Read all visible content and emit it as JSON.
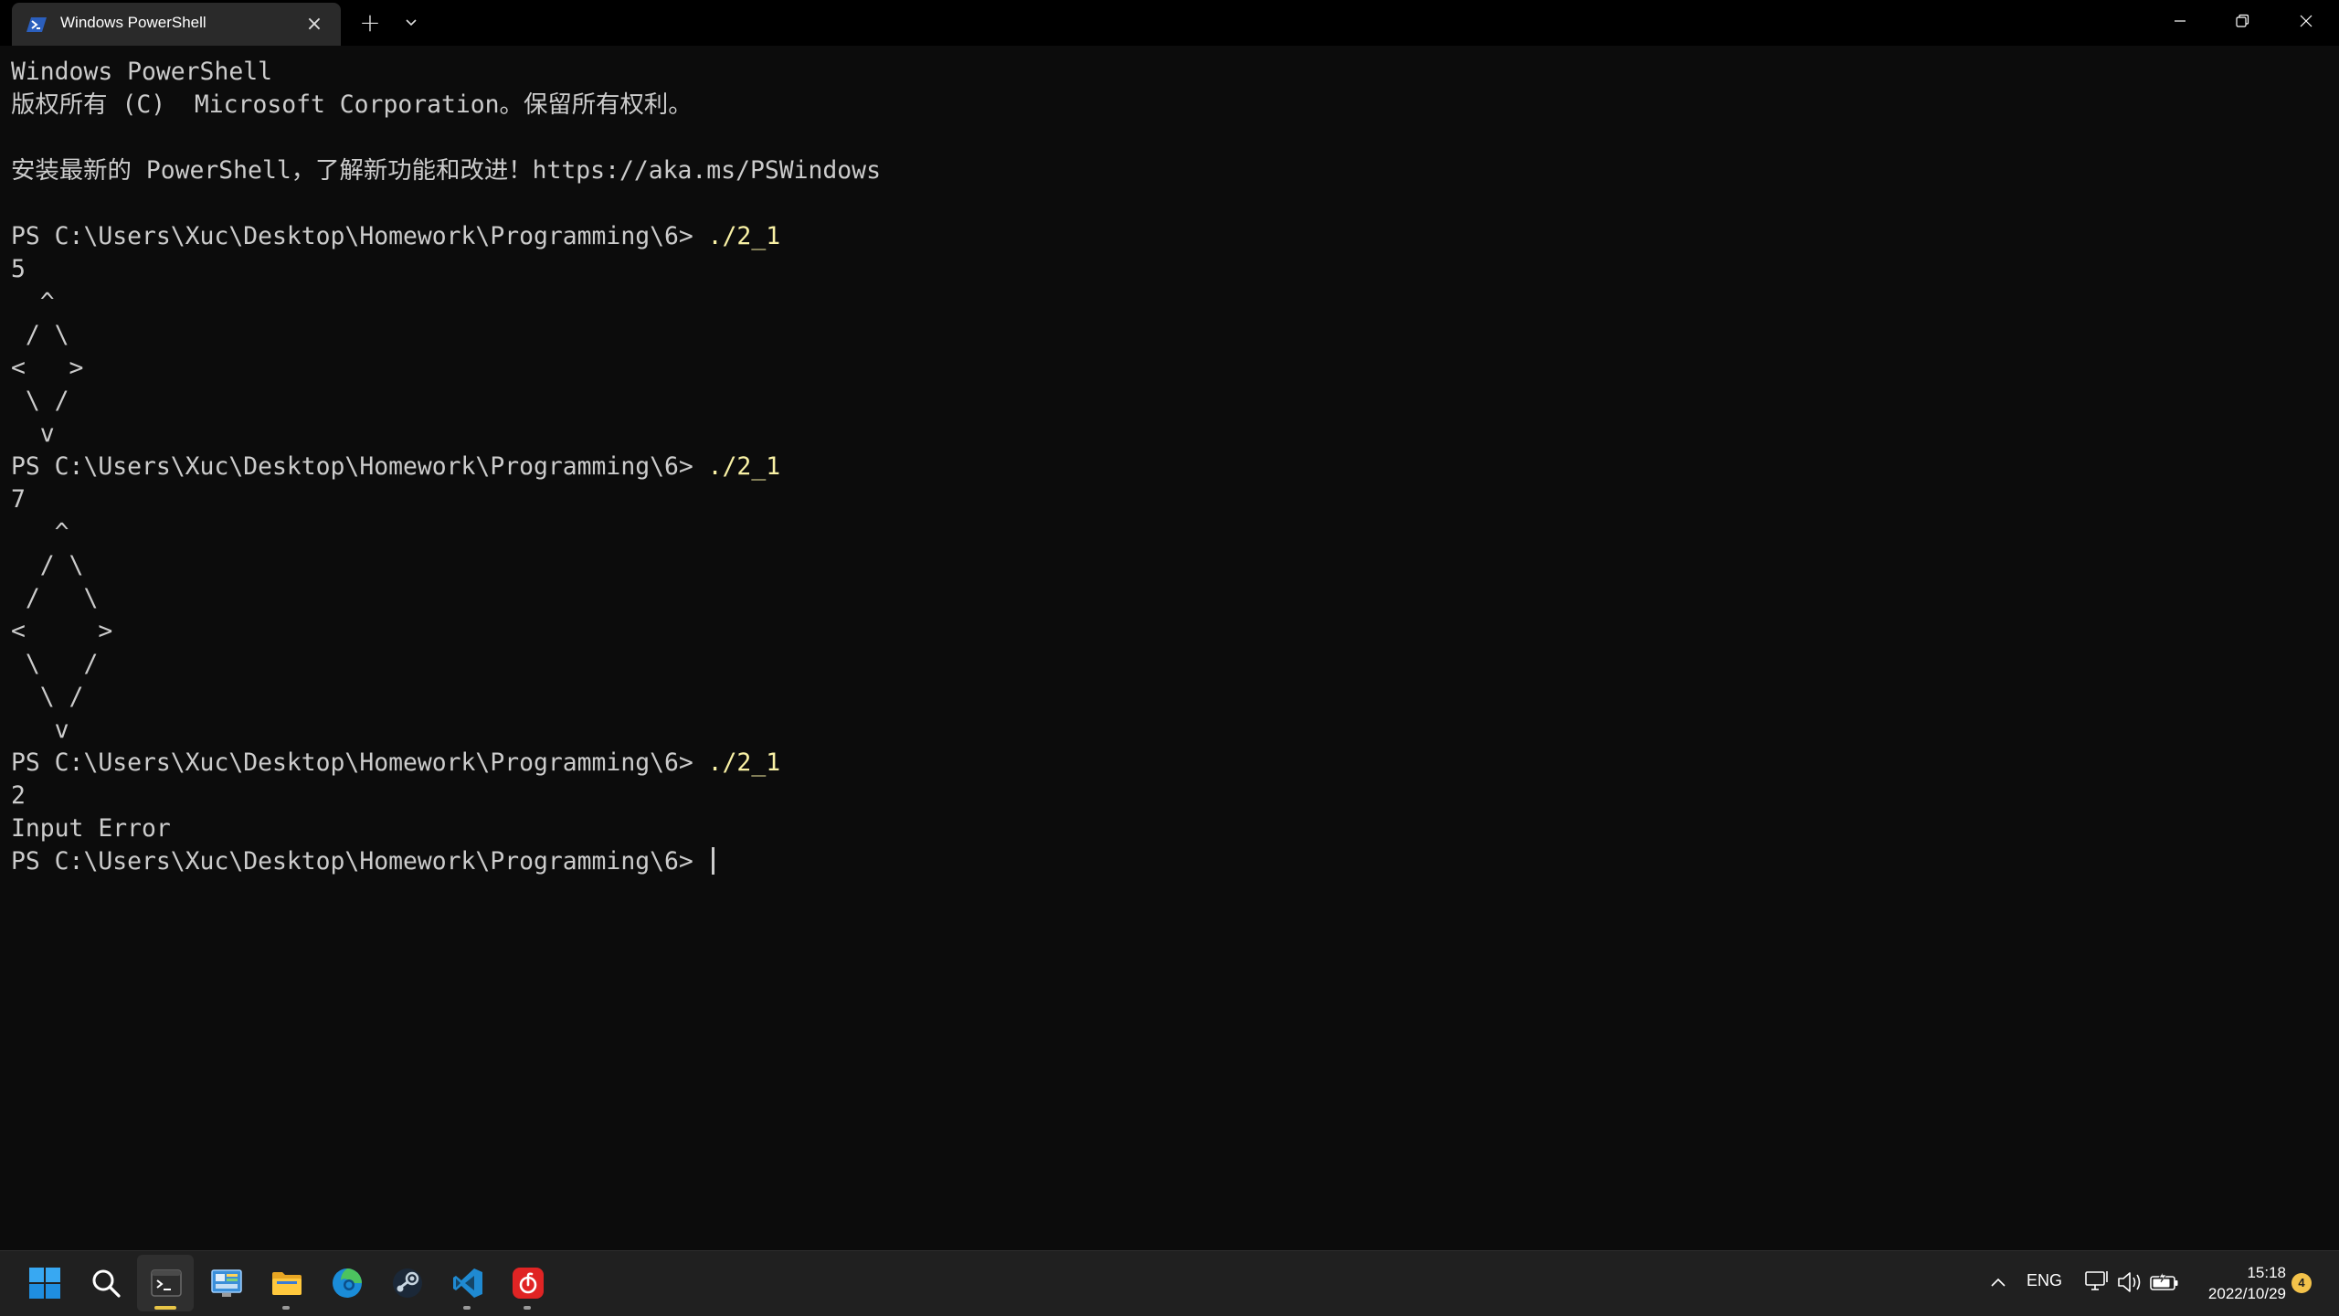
{
  "window": {
    "tab_title": "Windows PowerShell",
    "new_tab_label": "+",
    "close_tab_label": "×"
  },
  "terminal": {
    "lines": [
      {
        "text": "Windows PowerShell"
      },
      {
        "text": "版权所有 (C)  Microsoft Corporation。保留所有权利。"
      },
      {
        "text": ""
      },
      {
        "text": "安装最新的 PowerShell，了解新功能和改进！https://aka.ms/PSWindows"
      },
      {
        "text": ""
      },
      {
        "prompt": "PS C:\\Users\\Xuc\\Desktop\\Homework\\Programming\\6> ",
        "command": "./2_1"
      },
      {
        "text": "5"
      },
      {
        "text": "  ^"
      },
      {
        "text": " / \\"
      },
      {
        "text": "<   >"
      },
      {
        "text": " \\ /"
      },
      {
        "text": "  v"
      },
      {
        "prompt": "PS C:\\Users\\Xuc\\Desktop\\Homework\\Programming\\6> ",
        "command": "./2_1"
      },
      {
        "text": "7"
      },
      {
        "text": "   ^"
      },
      {
        "text": "  / \\"
      },
      {
        "text": " /   \\"
      },
      {
        "text": "<     >"
      },
      {
        "text": " \\   /"
      },
      {
        "text": "  \\ /"
      },
      {
        "text": "   v"
      },
      {
        "prompt": "PS C:\\Users\\Xuc\\Desktop\\Homework\\Programming\\6> ",
        "command": "./2_1"
      },
      {
        "text": "2"
      },
      {
        "text": "Input Error"
      },
      {
        "prompt": "PS C:\\Users\\Xuc\\Desktop\\Homework\\Programming\\6> ",
        "command": "",
        "cursor": true
      }
    ]
  },
  "taskbar": {
    "apps": [
      {
        "name": "start-button",
        "icon": "windows-logo-icon",
        "running": false
      },
      {
        "name": "search-button",
        "icon": "search-icon",
        "running": false
      },
      {
        "name": "taskbar-terminal",
        "icon": "terminal-icon",
        "running": true,
        "focused": true
      },
      {
        "name": "taskbar-control-panel",
        "icon": "control-panel-icon",
        "running": false
      },
      {
        "name": "taskbar-file-explorer",
        "icon": "folder-icon",
        "running": true
      },
      {
        "name": "taskbar-edge",
        "icon": "edge-icon",
        "running": false
      },
      {
        "name": "taskbar-steam",
        "icon": "steam-icon",
        "running": false
      },
      {
        "name": "taskbar-vscode",
        "icon": "vscode-icon",
        "running": true
      },
      {
        "name": "taskbar-netease-music",
        "icon": "netease-music-icon",
        "running": true
      }
    ],
    "tray": {
      "language": "ENG",
      "time": "15:18",
      "date": "2022/10/29",
      "notification_count": "4"
    }
  },
  "colors": {
    "background": "#0c0c0c",
    "foreground": "#cccccc",
    "command": "#f9f1a5",
    "taskbar": "#202020",
    "accent": "#e8c547"
  }
}
